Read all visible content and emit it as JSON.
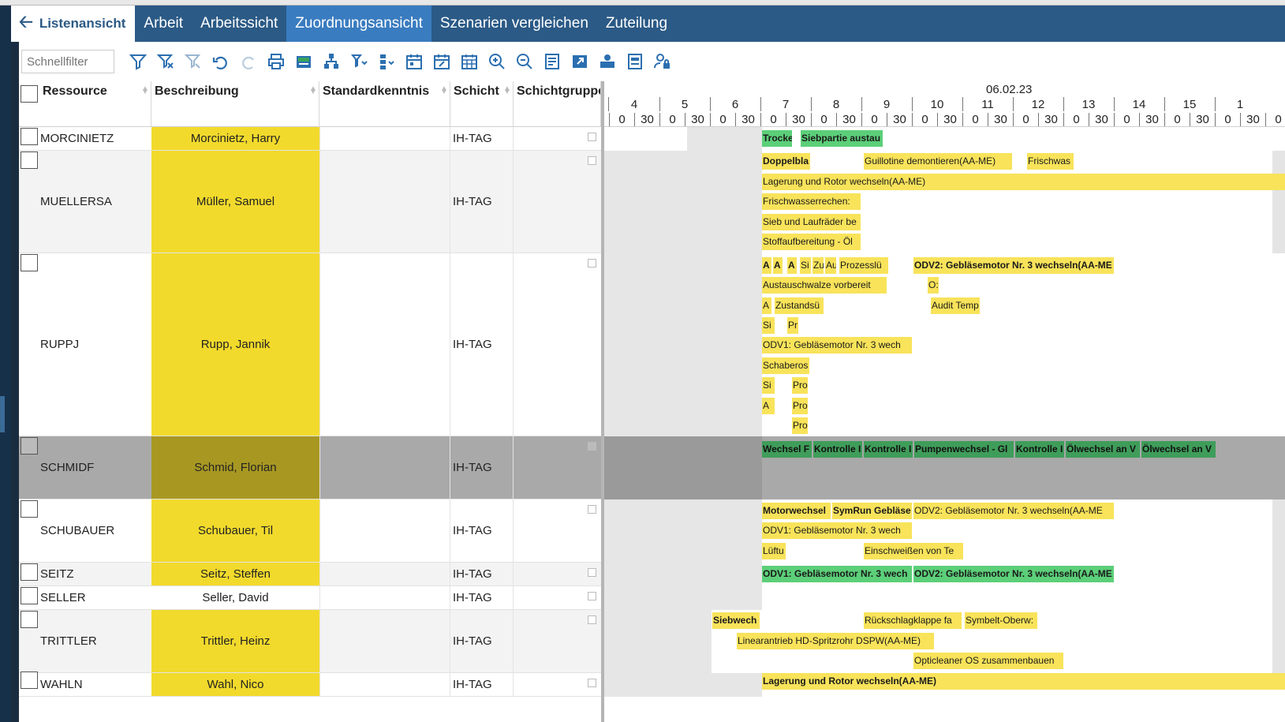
{
  "tabs": {
    "back_label": "Listenansicht",
    "items": [
      "Arbeit",
      "Arbeitssicht",
      "Zuordnungsansicht",
      "Szenarien vergleichen",
      "Zuteilung"
    ],
    "active": "Zuordnungsansicht"
  },
  "toolbar": {
    "quickfilter_placeholder": "Schnellfilter",
    "icons": [
      "filter-icon",
      "clear-filter-icon",
      "filter-disabled-icon",
      "undo-icon",
      "redo-icon",
      "print-icon",
      "excel-export-icon",
      "hierarchy-icon",
      "sort-filter-icon",
      "group-icon",
      "calendar-icon",
      "calendar-edit-icon",
      "calendar-grid-icon",
      "zoom-in-icon",
      "zoom-out-icon",
      "report-icon",
      "export-icon",
      "assign-icon",
      "settings-sheet-icon",
      "user-lock-icon"
    ]
  },
  "columns": {
    "resource": "Ressource",
    "description": "Beschreibung",
    "standard": "Standardkenntnis",
    "shift": "Schicht",
    "shiftgroup": "Schichtgruppe"
  },
  "timeline": {
    "date": "06.02.23",
    "hours": [
      "4",
      "5",
      "6",
      "7",
      "8",
      "9",
      "10",
      "11",
      "12",
      "13",
      "14",
      "15",
      "1"
    ],
    "halves": [
      "0",
      "30"
    ]
  },
  "rows": [
    {
      "id": "MORCINIETZ",
      "name": "Morcinietz, Harry",
      "shift": "IH-TAG",
      "yellow": true
    },
    {
      "id": "MUELLERSA",
      "name": "Müller, Samuel",
      "shift": "IH-TAG",
      "yellow": true
    },
    {
      "id": "RUPPJ",
      "name": "Rupp, Jannik",
      "shift": "IH-TAG",
      "yellow": true
    },
    {
      "id": "SCHMIDF",
      "name": "Schmid, Florian",
      "shift": "IH-TAG",
      "yellow": true
    },
    {
      "id": "SCHUBAUER",
      "name": "Schubauer, Til",
      "shift": "IH-TAG",
      "yellow": true
    },
    {
      "id": "SEITZ",
      "name": "Seitz, Steffen",
      "shift": "IH-TAG",
      "yellow": true
    },
    {
      "id": "SELLER",
      "name": "Seller, David",
      "shift": "IH-TAG",
      "yellow": false
    },
    {
      "id": "TRITTLER",
      "name": "Trittler, Heinz",
      "shift": "IH-TAG",
      "yellow": true
    },
    {
      "id": "WAHLN",
      "name": "Wahl, Nico",
      "shift": "IH-TAG",
      "yellow": true
    }
  ],
  "tasks": {
    "morcinietz": [
      "Trocke",
      "Siebpartie austau"
    ],
    "muellersa": [
      "Doppelbla",
      "Guillotine demontieren(AA-ME)",
      "Frischwas",
      "Lagerung und Rotor wechseln(AA-ME)",
      "Frischwasserrechen:",
      "Sieb und Laufräder be",
      "Stoffaufbereitung - Öl"
    ],
    "ruppj": [
      "A",
      "A",
      "A",
      "Si",
      "Zu",
      "Au",
      "Prozesslü",
      "ODV2: Gebläsemotor Nr. 3 wechseln(AA-ME",
      "Austauschwalze vorbereit",
      "O:",
      "A",
      "Zustandsü",
      "Audit Temp",
      "Si",
      "Pr",
      "ODV1: Gebläsemotor Nr. 3 wech",
      "Schaberos",
      "Si",
      "Pro",
      "A",
      "Pro",
      "Pro"
    ],
    "schmidf": [
      "Wechsel F",
      "Kontrolle I",
      "Kontrolle I",
      "Pumpenwechsel - Gl",
      "Kontrolle I",
      "Ölwechsel an V",
      "Ölwechsel an V"
    ],
    "schubauer": [
      "Motorwechsel",
      "SymRun Gebläse",
      "ODV2: Gebläsemotor Nr. 3 wechseln(AA-ME",
      "ODV1: Gebläsemotor Nr. 3 wech",
      "Lüftu",
      "Einschweißen von Te"
    ],
    "seitz": [
      "ODV1: Gebläsemotor Nr. 3 wech",
      "ODV2: Gebläsemotor Nr. 3 wechseln(AA-ME"
    ],
    "trittler": [
      "Siebwech",
      "Rückschlagklappe fa",
      "Symbelt-Oberw:",
      "Linearantrieb HD-Spritzrohr DSPW(AA-ME)",
      "Opticleaner OS zusammenbauen"
    ],
    "wahln": [
      "Lagerung und Rotor wechseln(AA-ME)"
    ]
  },
  "colors": {
    "tabbar": "#2b5a86",
    "tab_active": "#3a7cc0",
    "row_highlight": "#f2da2c",
    "task_yellow": "#f8e35a",
    "task_green": "#5ccf79",
    "task_dark_green": "#3f9d5a",
    "selected_row": "#a9a9a9"
  }
}
